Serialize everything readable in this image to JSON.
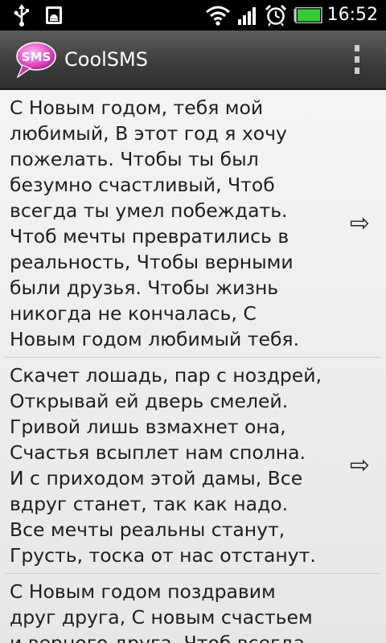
{
  "status_bar": {
    "time": "16:52",
    "icons": [
      "usb-icon",
      "android-debug-icon",
      "wifi-icon",
      "signal-icon",
      "alarm-icon",
      "battery-icon"
    ]
  },
  "action_bar": {
    "logo_text": "SMS",
    "title": "CoolSMS"
  },
  "messages": [
    {
      "text": "С Новым годом, тебя мой\nлюбимый, В этот год я хочу\nпожелать. Чтобы ты был\nбезумно счастливый, Чтоб\nвсегда ты умел побеждать.\nЧтоб мечты превратились в\nреальность, Чтобы верными\nбыли друзья. Чтобы жизнь\nникогда не кончалась, С\nНовым годом любимый тебя.",
      "arrow": "⇨"
    },
    {
      "text": "Скачет лошадь, пар с ноздрей,\nОткрывай ей дверь смелей.\nГривой лишь взмахнет она,\nСчастья всыплет нам сполна.\nИ с приходом этой дамы, Все\nвдруг станет, так как надо.\nВсе мечты реальны станут,\nГрусть, тоска от нас отстанут.",
      "arrow": "⇨"
    },
    {
      "text": "С Новым годом поздравим\nдруг друга, С новым счастьем\nи верного друга. Чтоб всегда",
      "arrow": "⇨"
    }
  ],
  "colors": {
    "status_bar": "#000000",
    "action_bar": "#3b3b3b",
    "list_background": "#eeeeee",
    "battery": "#33cc33"
  }
}
